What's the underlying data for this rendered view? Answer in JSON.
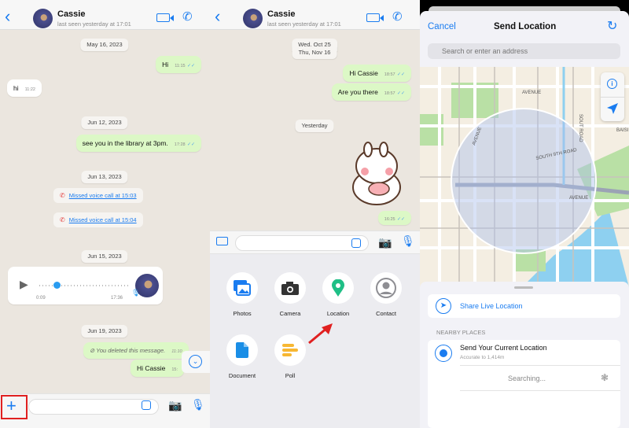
{
  "chat": {
    "contact_name": "Cassie",
    "last_seen": "last seen yesterday at 17:01"
  },
  "panel1": {
    "messages": [
      {
        "type": "date",
        "text": "May 16, 2023"
      },
      {
        "type": "out",
        "text": "Hi",
        "time": "11:15"
      },
      {
        "type": "in",
        "text": "hi",
        "time": "11:22"
      },
      {
        "type": "date",
        "text": "Jun 12, 2023"
      },
      {
        "type": "out",
        "text": "see you in the library at 3pm.",
        "time": "17:28"
      },
      {
        "type": "date",
        "text": "Jun 13, 2023"
      },
      {
        "type": "missed",
        "text": "Missed voice call at 15:03"
      },
      {
        "type": "missed",
        "text": "Missed voice call at 15:04"
      },
      {
        "type": "date",
        "text": "Jun 15, 2023"
      },
      {
        "type": "voice",
        "duration": "0:09",
        "time": "17:36"
      },
      {
        "type": "date",
        "text": "Jun 19, 2023"
      },
      {
        "type": "deleted",
        "text": "You deleted this message.",
        "time": "11:10"
      },
      {
        "type": "out",
        "text": "Hi Cassie",
        "time": "15:"
      }
    ]
  },
  "panel2": {
    "messages": [
      {
        "type": "date",
        "text": "Wed, Oct 25"
      },
      {
        "type": "date",
        "text": "Thu, Nov 16"
      },
      {
        "type": "out",
        "text": "Hi Cassie",
        "time": "18:57"
      },
      {
        "type": "out",
        "text": "Are you there",
        "time": "18:57"
      },
      {
        "type": "date",
        "text": "Yesterday"
      },
      {
        "type": "sticker",
        "time": "16:25"
      }
    ],
    "attachments": [
      {
        "label": "Photos",
        "icon": "photos-icon",
        "color": "#1a7cf0"
      },
      {
        "label": "Camera",
        "icon": "camera-icon",
        "color": "#333333"
      },
      {
        "label": "Location",
        "icon": "location-pin-icon",
        "color": "#1fbf86"
      },
      {
        "label": "Contact",
        "icon": "contact-icon",
        "color": "#8e8e93"
      },
      {
        "label": "Document",
        "icon": "document-icon",
        "color": "#1a8ee6"
      },
      {
        "label": "Poll",
        "icon": "poll-icon",
        "color": "#f7b733"
      }
    ]
  },
  "location": {
    "cancel": "Cancel",
    "title": "Send Location",
    "search_placeholder": "Search or enter an address",
    "map_labels": [
      "AVENUE",
      "AVENUE",
      "SOUTH 9TH ROAD",
      "AVENUE",
      "SOUT ROAD",
      "BAISI"
    ],
    "share_live": "Share Live Location",
    "nearby_header": "NEARBY PLACES",
    "current": "Send Your Current Location",
    "accuracy": "Accurate to 1,414m",
    "searching": "Searching..."
  },
  "colors": {
    "accent": "#1a7cf0",
    "outgoing": "#dcf8c6",
    "highlight": "#e02020"
  }
}
